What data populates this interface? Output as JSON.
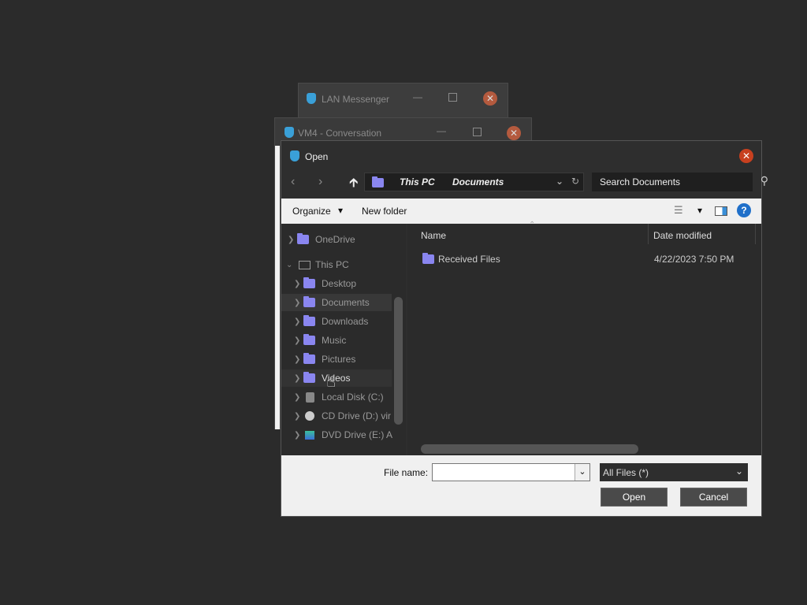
{
  "lan_window": {
    "title": "LAN Messenger"
  },
  "conv_window": {
    "title": "VM4 - Conversation"
  },
  "dialog": {
    "title": "Open",
    "address": {
      "segment1": "This PC",
      "segment2": "Documents"
    },
    "search": {
      "placeholder": "Search Documents"
    },
    "toolbar": {
      "organize": "Organize",
      "new_folder": "New folder"
    },
    "nav": [
      {
        "label": "OneDrive"
      },
      {
        "label": "This PC"
      },
      {
        "label": "Desktop"
      },
      {
        "label": "Documents"
      },
      {
        "label": "Downloads"
      },
      {
        "label": "Music"
      },
      {
        "label": "Pictures"
      },
      {
        "label": "Videos"
      },
      {
        "label": "Local Disk (C:)"
      },
      {
        "label": "CD Drive (D:) vir"
      },
      {
        "label": "DVD Drive (E:) A"
      }
    ],
    "columns": {
      "name": "Name",
      "date_modified": "Date modified"
    },
    "files": [
      {
        "name": "Received Files",
        "date": "4/22/2023 7:50 PM"
      }
    ],
    "filename_label": "File name:",
    "filename_value": "",
    "filetype": "All Files  (*)",
    "open_label": "Open",
    "cancel_label": "Cancel"
  }
}
